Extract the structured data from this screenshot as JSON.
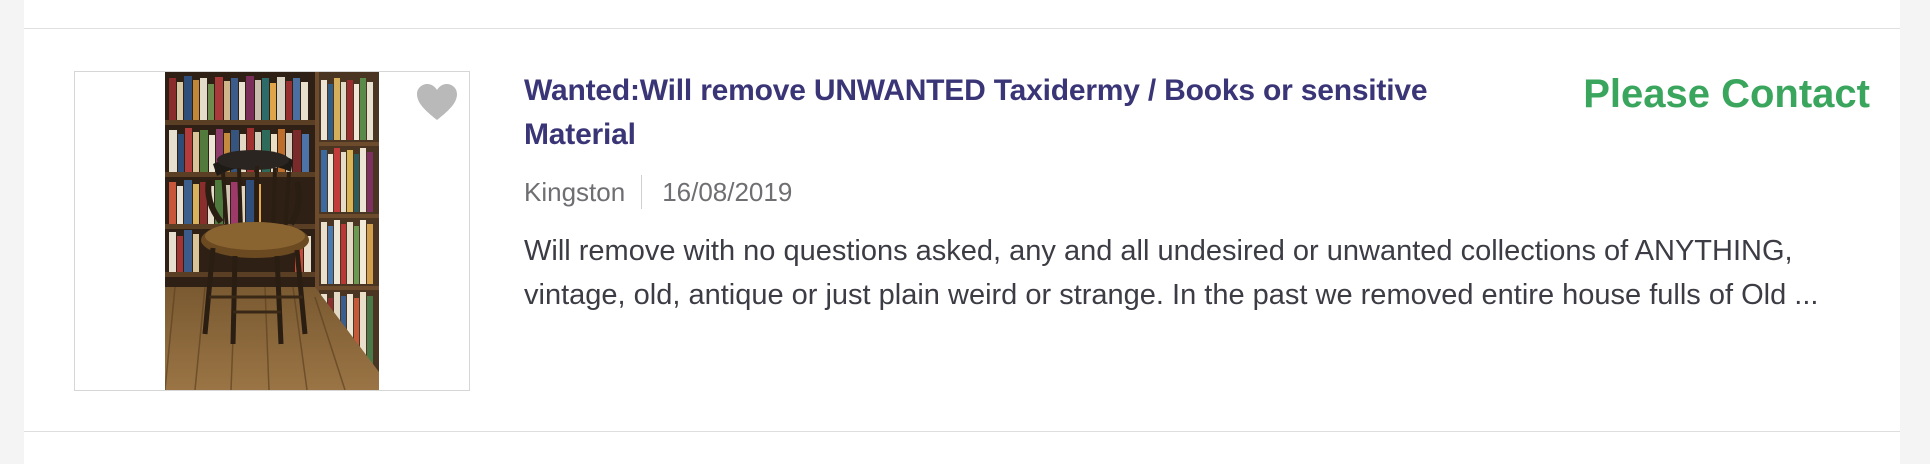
{
  "listing": {
    "title": "Wanted:Will remove UNWANTED Taxidermy / Books or sensitive Material",
    "price": "Please Contact",
    "location": "Kingston",
    "date": "16/08/2019",
    "description": "Will remove with no questions asked, any and all undesired or unwanted collections of ANYTHING, vintage, old, antique or just plain weird or strange. In the past we removed entire house fulls of Old ...",
    "favorite_icon": "heart-icon",
    "thumbnail_subject": "photo-of-wooden-chair-beside-bookshelves"
  },
  "colors": {
    "title": "#3a3576",
    "price": "#3aa55d",
    "meta": "#6e6e73",
    "description": "#3c3c45"
  }
}
